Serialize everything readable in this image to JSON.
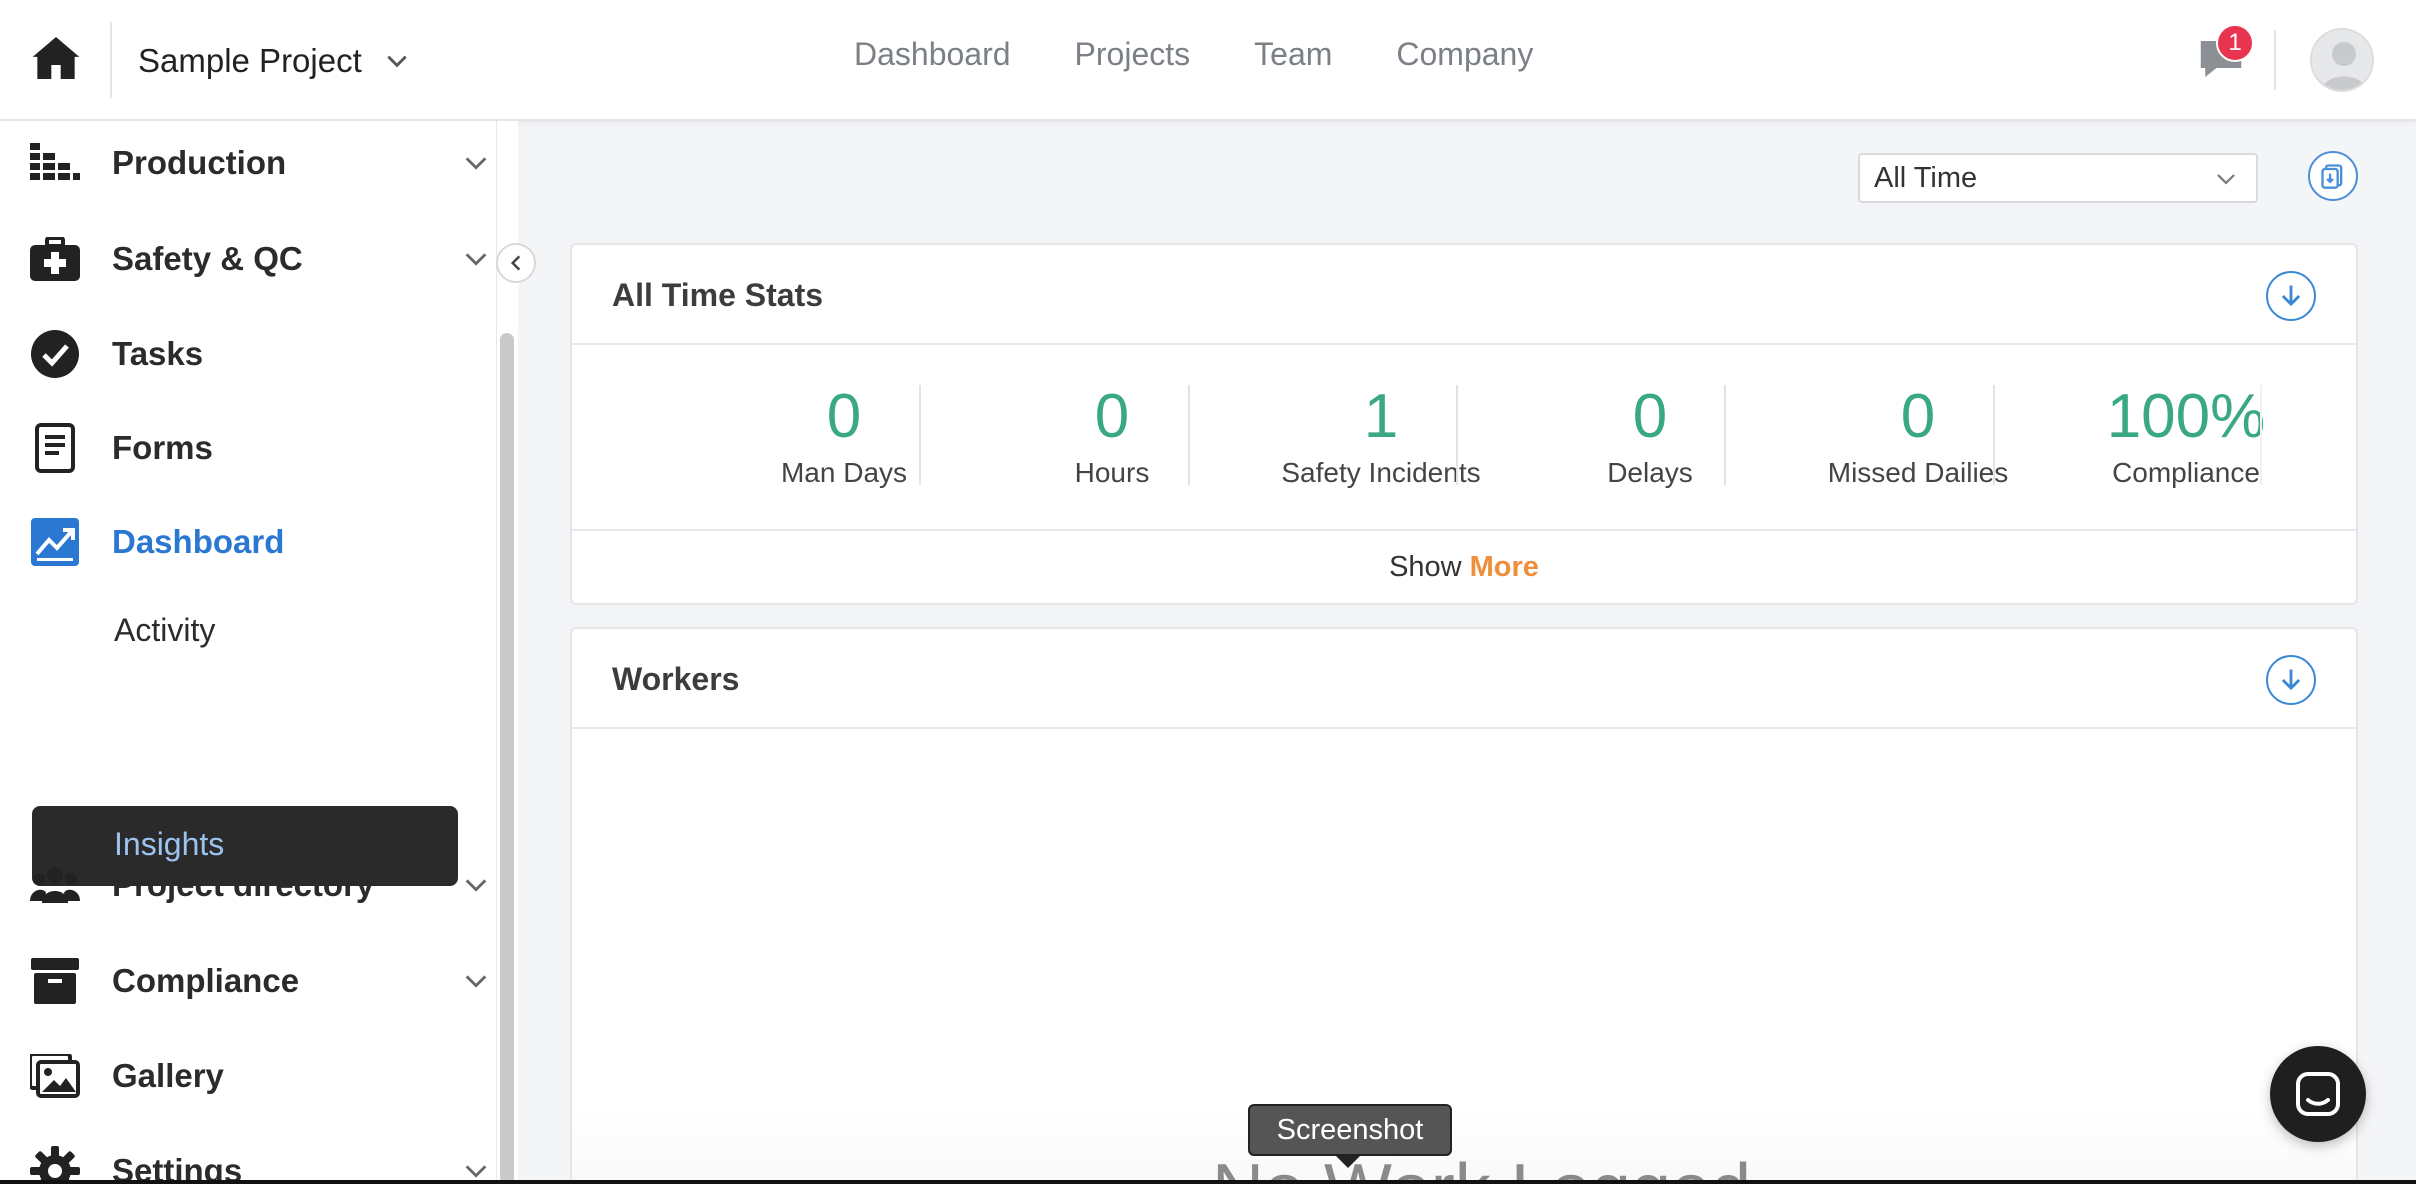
{
  "topbar": {
    "project_name": "Sample Project",
    "nav": [
      "Dashboard",
      "Projects",
      "Team",
      "Company"
    ],
    "notification_count": "1"
  },
  "sidebar": {
    "items": [
      {
        "label": "Production",
        "icon": "production-icon",
        "has_chevron": true
      },
      {
        "label": "Safety & QC",
        "icon": "medkit-icon",
        "has_chevron": true
      },
      {
        "label": "Tasks",
        "icon": "check-circle-icon",
        "has_chevron": false
      },
      {
        "label": "Forms",
        "icon": "form-icon",
        "has_chevron": false
      },
      {
        "label": "Dashboard",
        "icon": "chart-icon",
        "has_chevron": false,
        "active": true
      },
      {
        "label": "Project directory",
        "icon": "people-icon",
        "has_chevron": true
      },
      {
        "label": "Compliance",
        "icon": "archive-icon",
        "has_chevron": true
      },
      {
        "label": "Gallery",
        "icon": "gallery-icon",
        "has_chevron": false
      },
      {
        "label": "Settings",
        "icon": "gear-icon",
        "has_chevron": true
      }
    ],
    "sub_items": [
      "Activity",
      "Insights"
    ],
    "active_sub": "Insights"
  },
  "main": {
    "range": "All Time",
    "stats_card": {
      "title": "All Time Stats",
      "stats": [
        {
          "value": "0",
          "label": "Man Days"
        },
        {
          "value": "0",
          "label": "Hours"
        },
        {
          "value": "1",
          "label": "Safety Incidents"
        },
        {
          "value": "0",
          "label": "Delays"
        },
        {
          "value": "0",
          "label": "Missed Dailies"
        },
        {
          "value": "100%",
          "label": "Compliance"
        }
      ],
      "show_label": "Show",
      "more_label": "More"
    },
    "workers_card": {
      "title": "Workers",
      "empty_text": "No Work Logged",
      "axis_fragment": "s"
    }
  },
  "tooltip": "Screenshot",
  "colors": {
    "accent_blue": "#2a78d2",
    "stat_green": "#3aa883",
    "more_orange": "#ef8f3c",
    "badge_red": "#e8344e"
  }
}
